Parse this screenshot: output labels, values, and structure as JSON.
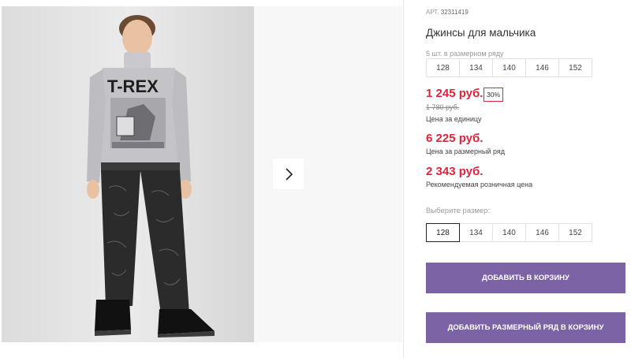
{
  "product": {
    "sku_label": "АРТ.",
    "sku_value": "32311419",
    "title": "Джинсы для мальчика"
  },
  "gallery": {
    "print_text": "T-REX",
    "next_icon": "chevron-right-icon"
  },
  "size_set": {
    "hint": "5 шт. в размерном ряду",
    "sizes": [
      "128",
      "134",
      "140",
      "146",
      "152"
    ]
  },
  "prices": {
    "unit_price": "1 245 руб.",
    "discount": "30%",
    "old_price": "1 780 руб.",
    "unit_label": "Цена за единицу",
    "set_price": "6 225 руб.",
    "set_label": "Цена за размерный ряд",
    "rrp_price": "2 343 руб.",
    "rrp_label": "Рекомендуемая розничная цена"
  },
  "size_select": {
    "label": "Выберите размер:",
    "sizes": [
      "128",
      "134",
      "140",
      "146",
      "152"
    ],
    "selected": "128"
  },
  "actions": {
    "add_to_cart": "ДОБАВИТЬ В КОРЗИНУ",
    "add_set_to_cart": "ДОБАВИТЬ РАЗМЕРНЫЙ РЯД В КОРЗИНУ"
  },
  "colors": {
    "price_red": "#e2213b",
    "button_purple": "#7c63a6"
  }
}
